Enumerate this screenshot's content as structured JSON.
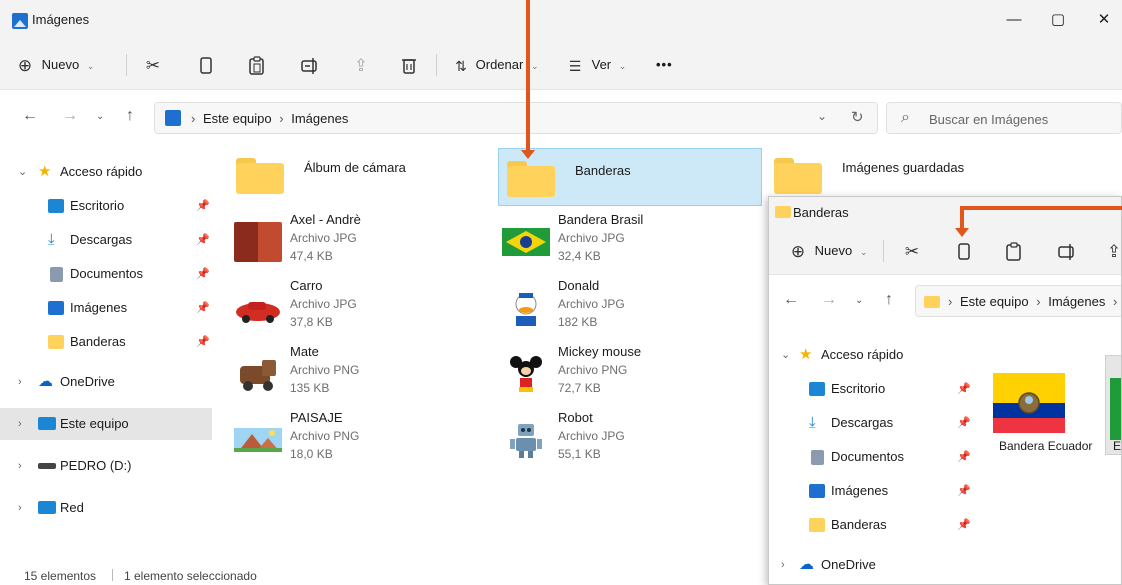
{
  "window": {
    "title": "Imágenes",
    "controls": {
      "minimize": "—",
      "maximize": "▢",
      "close": "✕"
    }
  },
  "toolbar": {
    "new_label": "Nuevo",
    "sort_label": "Ordenar",
    "view_label": "Ver",
    "more_label": "•••"
  },
  "address": {
    "root": "Este equipo",
    "current": "Imágenes",
    "search_placeholder": "Buscar en Imágenes"
  },
  "sidebar": {
    "quick_access": "Acceso rápido",
    "items": [
      {
        "label": "Escritorio"
      },
      {
        "label": "Descargas"
      },
      {
        "label": "Documentos"
      },
      {
        "label": "Imágenes"
      },
      {
        "label": "Banderas"
      }
    ],
    "onedrive": "OneDrive",
    "this_pc": "Este equipo",
    "drive": "PEDRO (D:)",
    "network": "Red"
  },
  "folders": [
    {
      "name": "Álbum de cámara"
    },
    {
      "name": "Banderas"
    },
    {
      "name": "Imágenes guardadas"
    }
  ],
  "files": [
    {
      "name": "Axel - Andrè",
      "type": "Archivo JPG",
      "size": "47,4 KB"
    },
    {
      "name": "Bandera Brasil",
      "type": "Archivo JPG",
      "size": "32,4 KB"
    },
    {
      "name": "Carro",
      "type": "Archivo JPG",
      "size": "37,8 KB"
    },
    {
      "name": "Donald",
      "type": "Archivo JPG",
      "size": "182 KB"
    },
    {
      "name": "Mate",
      "type": "Archivo PNG",
      "size": "135 KB"
    },
    {
      "name": "Mickey mouse",
      "type": "Archivo PNG",
      "size": "72,7 KB"
    },
    {
      "name": "PAISAJE",
      "type": "Archivo PNG",
      "size": "18,0 KB"
    },
    {
      "name": "Robot",
      "type": "Archivo JPG",
      "size": "55,1 KB"
    }
  ],
  "status": {
    "count": "15 elementos",
    "selection": "1 elemento seleccionado"
  },
  "window2": {
    "title": "Banderas",
    "new_label": "Nuevo",
    "breadcrumb_root": "Este equipo",
    "breadcrumb_current": "Imágenes",
    "quick_access": "Acceso rápido",
    "items": [
      {
        "label": "Escritorio"
      },
      {
        "label": "Descargas"
      },
      {
        "label": "Documentos"
      },
      {
        "label": "Imágenes"
      },
      {
        "label": "Banderas"
      }
    ],
    "onedrive": "OneDrive",
    "file_label": "Bandera Ecuador",
    "partial_label": "E"
  },
  "colors": {
    "accent": "#e0561c",
    "selection": "#cde8f7",
    "folder": "#ffd35b"
  }
}
